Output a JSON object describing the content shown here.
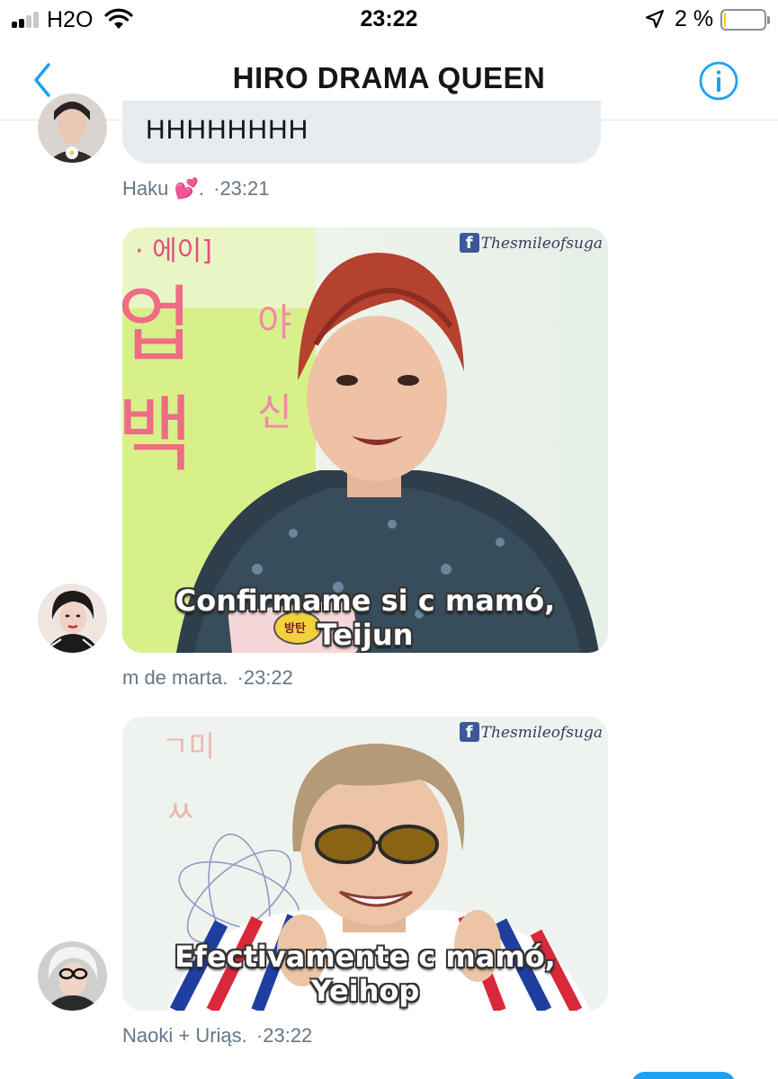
{
  "status_bar": {
    "carrier": "H2O",
    "time": "23:22",
    "battery_percent": "2 %",
    "battery_level": 0.02,
    "signal_bars_active": 2,
    "icons": [
      "signal-icon",
      "wifi-icon",
      "location-arrow-icon",
      "battery-icon"
    ]
  },
  "header": {
    "title": "HIRO DRAMA QUEEN",
    "back_icon": "chevron-left-icon",
    "info_icon": "info-circle-icon",
    "accent_color": "#1da1f2"
  },
  "messages": [
    {
      "type": "text",
      "text": "HHHHHHHH",
      "sender": "Haku 💕.",
      "separator": "·",
      "time": "23:21"
    },
    {
      "type": "image",
      "caption_line1": "Confirmame si c mamó,",
      "caption_line2": "Teijun",
      "watermark": "Thesmileofsuga",
      "sign_text": "· 에이]",
      "badge_text": "방탄",
      "sender": "m de marta.",
      "separator": "·",
      "time": "23:22"
    },
    {
      "type": "image",
      "caption_line1": "Efectivamente c mamó,",
      "caption_line2": "Yeihop",
      "watermark": "Thesmileofsuga",
      "sender": "Naoki + Uriąs.",
      "separator": "·",
      "time": "23:22"
    }
  ]
}
